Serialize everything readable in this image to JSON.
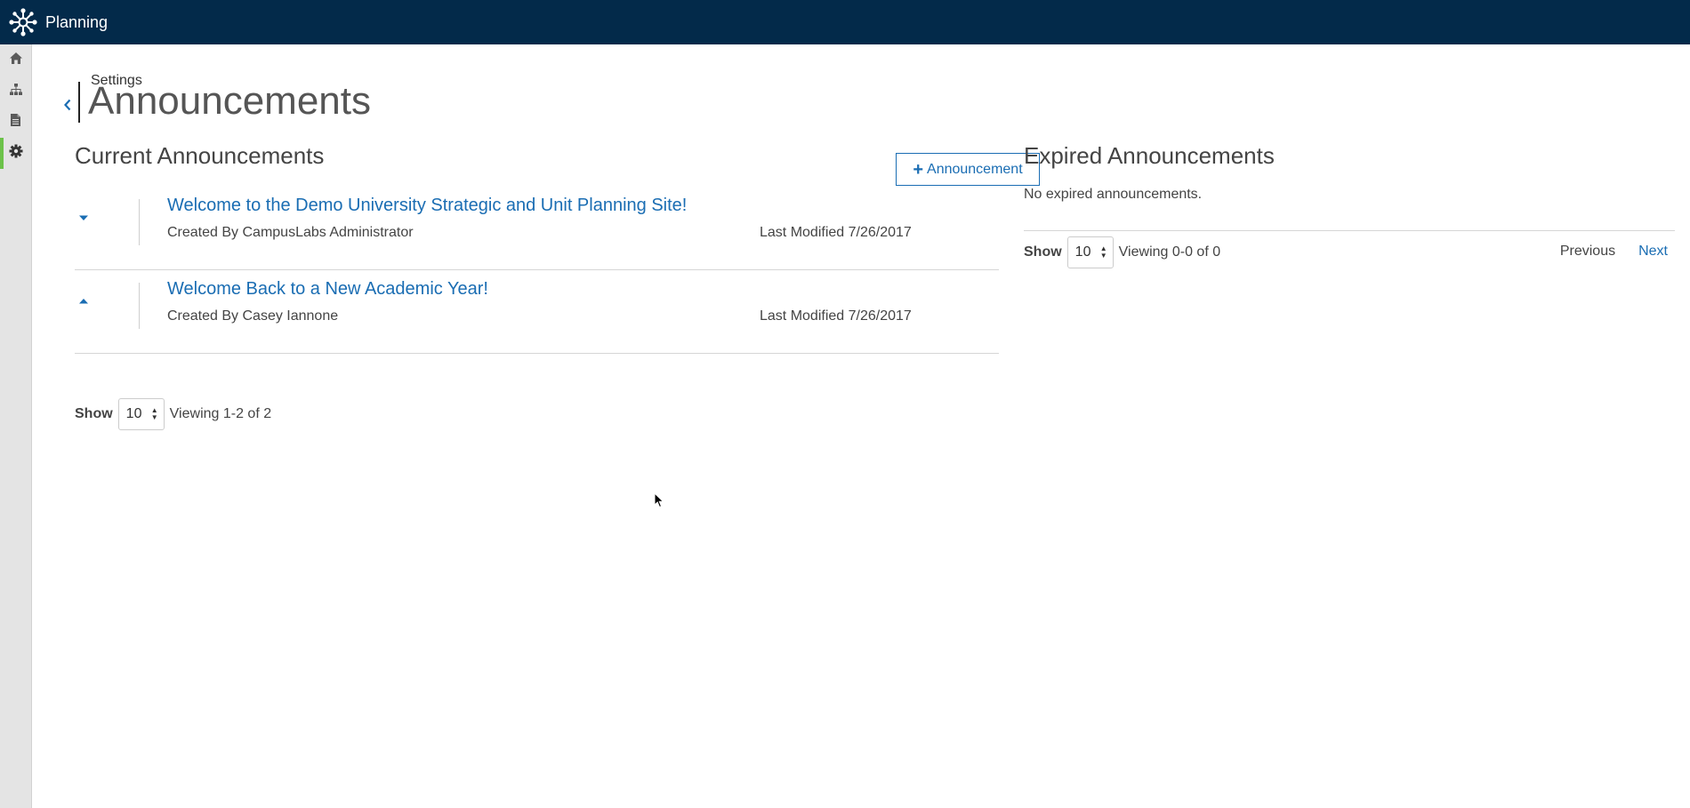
{
  "app": {
    "title": "Planning"
  },
  "sidebar": {
    "items": [
      {
        "icon": "home-icon"
      },
      {
        "icon": "org-chart-icon"
      },
      {
        "icon": "document-icon"
      },
      {
        "icon": "gear-icon",
        "active": true
      }
    ]
  },
  "header": {
    "breadcrumb": "Settings",
    "title": "Announcements"
  },
  "current": {
    "title": "Current Announcements",
    "add_button": "Announcement",
    "announcements": [
      {
        "title": "Welcome to the Demo University Strategic and Unit Planning Site!",
        "created_by": "Created By CampusLabs Administrator",
        "last_modified": "Last Modified 7/26/2017",
        "expanded": false
      },
      {
        "title": "Welcome Back to a New Academic Year!",
        "created_by": "Created By Casey Iannone",
        "last_modified": "Last Modified 7/26/2017",
        "expanded": true
      }
    ],
    "pager": {
      "show_label": "Show",
      "page_size": "10",
      "viewing": "Viewing 1-2 of 2"
    }
  },
  "expired": {
    "title": "Expired Announcements",
    "empty_text": "No expired announcements.",
    "pager": {
      "show_label": "Show",
      "page_size": "10",
      "viewing": "Viewing 0-0 of 0",
      "previous": "Previous",
      "next": "Next"
    }
  },
  "colors": {
    "topbar": "#032a4a",
    "accent": "#1a6db3",
    "active_indicator": "#6cc24a"
  }
}
